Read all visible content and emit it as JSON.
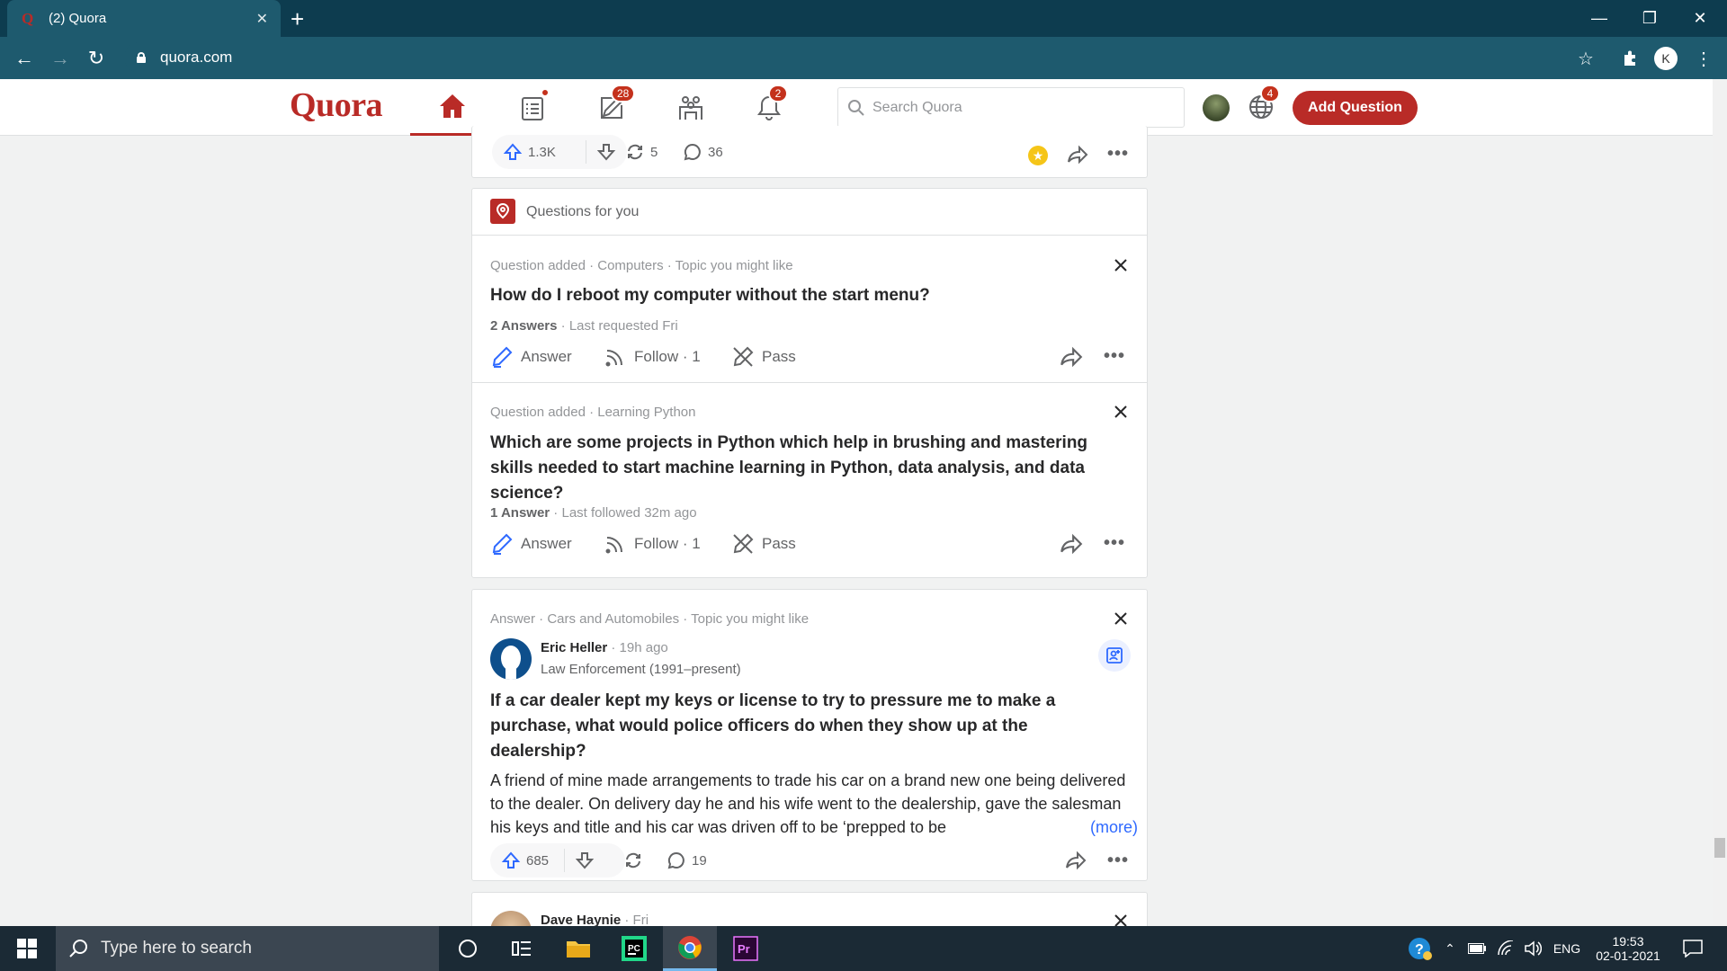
{
  "browser": {
    "tab_title": "(2) Quora",
    "url": "quora.com"
  },
  "quora": {
    "logo": "Quora",
    "badges": {
      "answer": "28",
      "notifications": "2",
      "languages": "4"
    },
    "search_placeholder": "Search Quora",
    "add_question": "Add Question"
  },
  "top_stats": {
    "upvotes": "1.3K",
    "shares": "5",
    "comments": "36"
  },
  "qfy": {
    "header": "Questions for you",
    "items": [
      {
        "meta": "Question added · Computers · Topic you might like",
        "title": "How do I reboot my computer without the start menu?",
        "count": "2 Answers",
        "detail": " · Last requested Fri",
        "answer": "Answer",
        "follow": "Follow · 1",
        "pass": "Pass"
      },
      {
        "meta": "Question added · Learning Python",
        "title": "Which are some projects in Python which help in brushing and mastering skills needed to start machine learning in Python, data analysis, and data science?",
        "count": "1 Answer",
        "detail": " · Last followed 32m ago",
        "answer": "Answer",
        "follow": "Follow · 1",
        "pass": "Pass"
      }
    ]
  },
  "answer_card": {
    "meta": "Answer · Cars and Automobiles · Topic you might like",
    "author": "Eric Heller",
    "time": " · 19h ago",
    "credential": "Law Enforcement (1991–present)",
    "title": "If a car dealer kept my keys or license to try to pressure me to make a purchase, what would police officers do when they show up at the dealership?",
    "body": "A friend of mine made arrangements to trade his car on a brand new one being delivered to the dealer. On delivery day he and his wife went to the dealership, gave the salesman his keys and title and his car was driven off to be ‘prepped to be",
    "more": "(more)",
    "upvotes": "685",
    "comments": "19"
  },
  "next_card": {
    "author": "Dave Haynie",
    "time": " · Fri"
  },
  "taskbar": {
    "search_placeholder": "Type here to search",
    "lang": "ENG",
    "time": "19:53",
    "date": "02-01-2021"
  },
  "colors": {
    "brand": "#b92b27",
    "chrome_dark": "#0d3c4f",
    "chrome": "#1e5a6e",
    "taskbar": "#1b2a35"
  }
}
